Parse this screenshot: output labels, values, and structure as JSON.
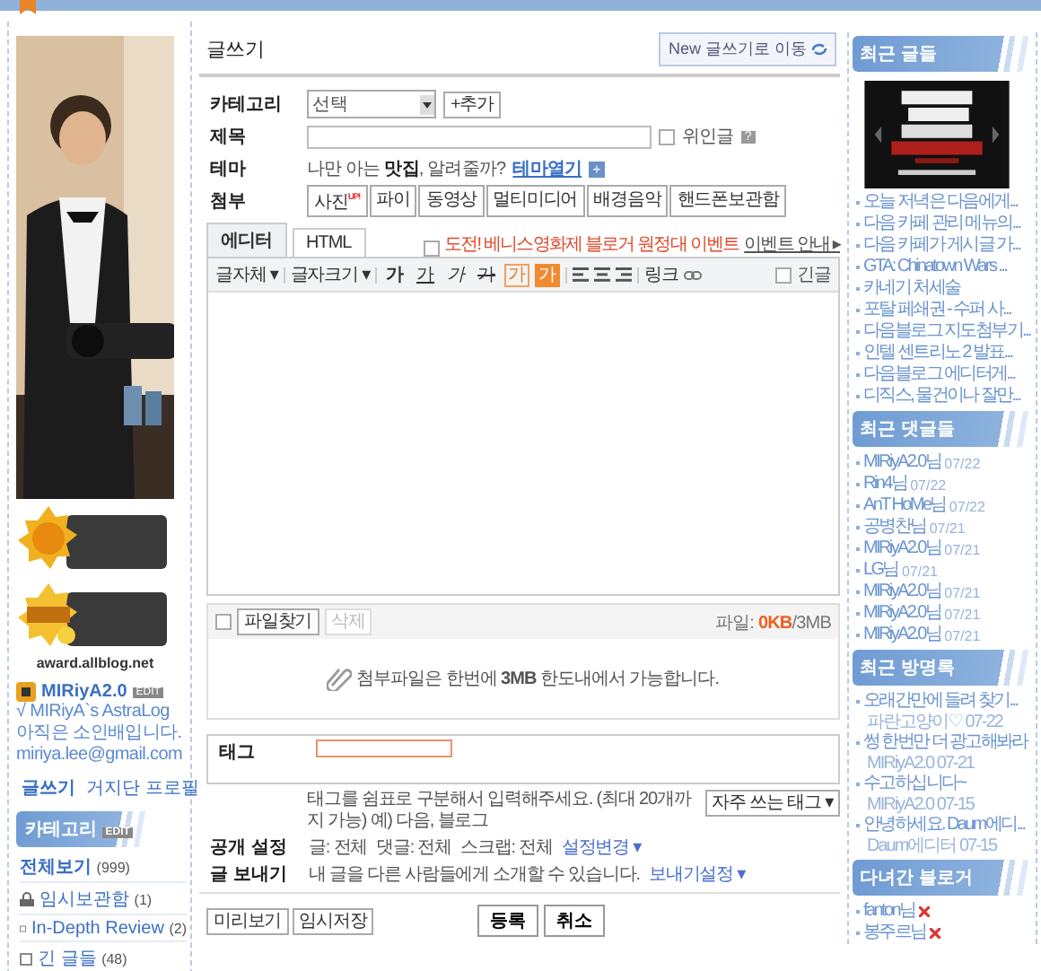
{
  "award_caption": "award.allblog.net",
  "profile": {
    "name": "MIRiyA2.0",
    "badge": "EDIT",
    "blog_title": "√ MIRiyA`s AstraLog",
    "description": "아직은 소인배입니다.",
    "email": "miriya.lee@gmail.com",
    "links": [
      {
        "label": "글쓰기",
        "kind": "write"
      },
      {
        "label": "거지단",
        "kind": "note"
      },
      {
        "label": "프로필",
        "kind": "plain"
      }
    ]
  },
  "categories": {
    "title": "카테고리",
    "badge": "EDIT",
    "items": [
      {
        "label": "전체보기",
        "count": "(999)",
        "kind": "all"
      },
      {
        "label": "임시보관함",
        "count": "(1)",
        "kind": "lock"
      },
      {
        "label": "In-Depth Review",
        "count": "(2)",
        "kind": "folder"
      },
      {
        "label": "긴 글들",
        "count": "(48)",
        "kind": "folder"
      }
    ]
  },
  "editor": {
    "title": "글쓰기",
    "new_button": "New 글쓰기로 이동",
    "category": {
      "label": "카테고리",
      "select": "선택",
      "add_button": "+추가"
    },
    "subject": {
      "label": "제목",
      "checkbox": "위인글",
      "checked": false,
      "help_icon": "?"
    },
    "theme": {
      "label": "테마",
      "text": "나만 아는 **맛집**, 알려줄까?",
      "link": "테마열기",
      "expand_icon": "+"
    },
    "attach": {
      "label": "첨부",
      "buttons": [
        {
          "label": "사진",
          "badge": "UP!"
        },
        {
          "label": "파이"
        },
        {
          "label": "동영상"
        },
        {
          "label": "멀티미디어"
        },
        {
          "label": "배경음악"
        },
        {
          "label": "핸드폰보관함"
        }
      ]
    },
    "tabs": [
      {
        "label": "에디터",
        "selected": true
      },
      {
        "label": "HTML",
        "selected": false
      }
    ],
    "event": {
      "label": "도전! 베니스영화제 블로거 원정대 이벤트",
      "checked": false,
      "link": "이벤트 안내 ▸"
    },
    "toolbar": {
      "font": "글자체 ▾",
      "size": "글자크기 ▾",
      "styles": [
        {
          "label": "가",
          "kind": "bold"
        },
        {
          "label": "가",
          "kind": "underline"
        },
        {
          "label": "가",
          "kind": "italic"
        },
        {
          "label": "가",
          "kind": "strike"
        },
        {
          "label": "가",
          "kind": "color"
        },
        {
          "label": "가",
          "kind": "highlight"
        }
      ],
      "link": "링크",
      "long_post": "긴글",
      "long_checked": false
    },
    "files": {
      "select_all_checked": false,
      "find_button": "파일찾기",
      "delete_button": "삭제",
      "delete_disabled": true,
      "usage": "파일: **0KB**/3MB",
      "message": "첨부파일은 한번에 **3MB** 한도내에서 가능합니다."
    },
    "tag": {
      "label": "태그",
      "hint": "태그를 쉼표로 구분해서 입력해주세요. (최대 20개까지 가능) 예) 다음, 블로그",
      "button": "자주 쓰는 태그 ▾"
    },
    "publish": {
      "label": "공개 설정",
      "values": [
        "글: 전체",
        "댓글: 전체",
        "스크랩: 전체"
      ],
      "link": "설정변경 ▾"
    },
    "send": {
      "label": "글 보내기",
      "text": "내 글을 다른 사람들에게 소개할 수 있습니다.",
      "link": "보내기설정 ▾"
    },
    "left_buttons": [
      "미리보기",
      "임시저장"
    ],
    "main_buttons": [
      "등록",
      "취소"
    ]
  },
  "recent_posts": {
    "title": "최근 글들",
    "items": [
      "오늘 저녁은 다음에게...",
      "다음 카페 관리 메뉴의...",
      "다음 카페가 게시글 가...",
      "GTA: Chinatown Wars ...",
      "카네기 처세술",
      "포탈 페쇄권 - 수퍼 사...",
      "다음블로그 지도첨부기...",
      "인텔 센트리노 2 발표...",
      "다음블로그 에디터게...",
      "디직스, 물건이나 잘만..."
    ]
  },
  "recent_comments": {
    "title": "최근 댓글들",
    "items": [
      {
        "name": "MIRiyA2.0님",
        "date": "07/22"
      },
      {
        "name": "Rin4님",
        "date": "07/22"
      },
      {
        "name": "AnT HoMe님",
        "date": "07/22"
      },
      {
        "name": "공병찬님",
        "date": "07/21"
      },
      {
        "name": "MIRiyA2.0님",
        "date": "07/21"
      },
      {
        "name": "LG님",
        "date": "07/21"
      },
      {
        "name": "MIRiyA2.0님",
        "date": "07/21"
      },
      {
        "name": "MIRiyA2.0님",
        "date": "07/21"
      },
      {
        "name": "MIRiyA2.0님",
        "date": "07/21"
      }
    ]
  },
  "guestbook": {
    "title": "최근 방명록",
    "items": [
      {
        "text": "오래간만에 들려 찾기...",
        "meta": "파란고양이♡ 07-22"
      },
      {
        "text": "썽 한번만 더 광고해봐라",
        "meta": "MIRiyA2.0 07-21"
      },
      {
        "text": "수고하십니다~",
        "meta": "MIRiyA2.0 07-15"
      },
      {
        "text": "안녕하세요. Daum에디...",
        "meta": "Daum에디터 07-15"
      }
    ]
  },
  "visitors": {
    "title": "다녀간 블로거",
    "items": [
      "fanton님",
      "봉주르님"
    ]
  }
}
